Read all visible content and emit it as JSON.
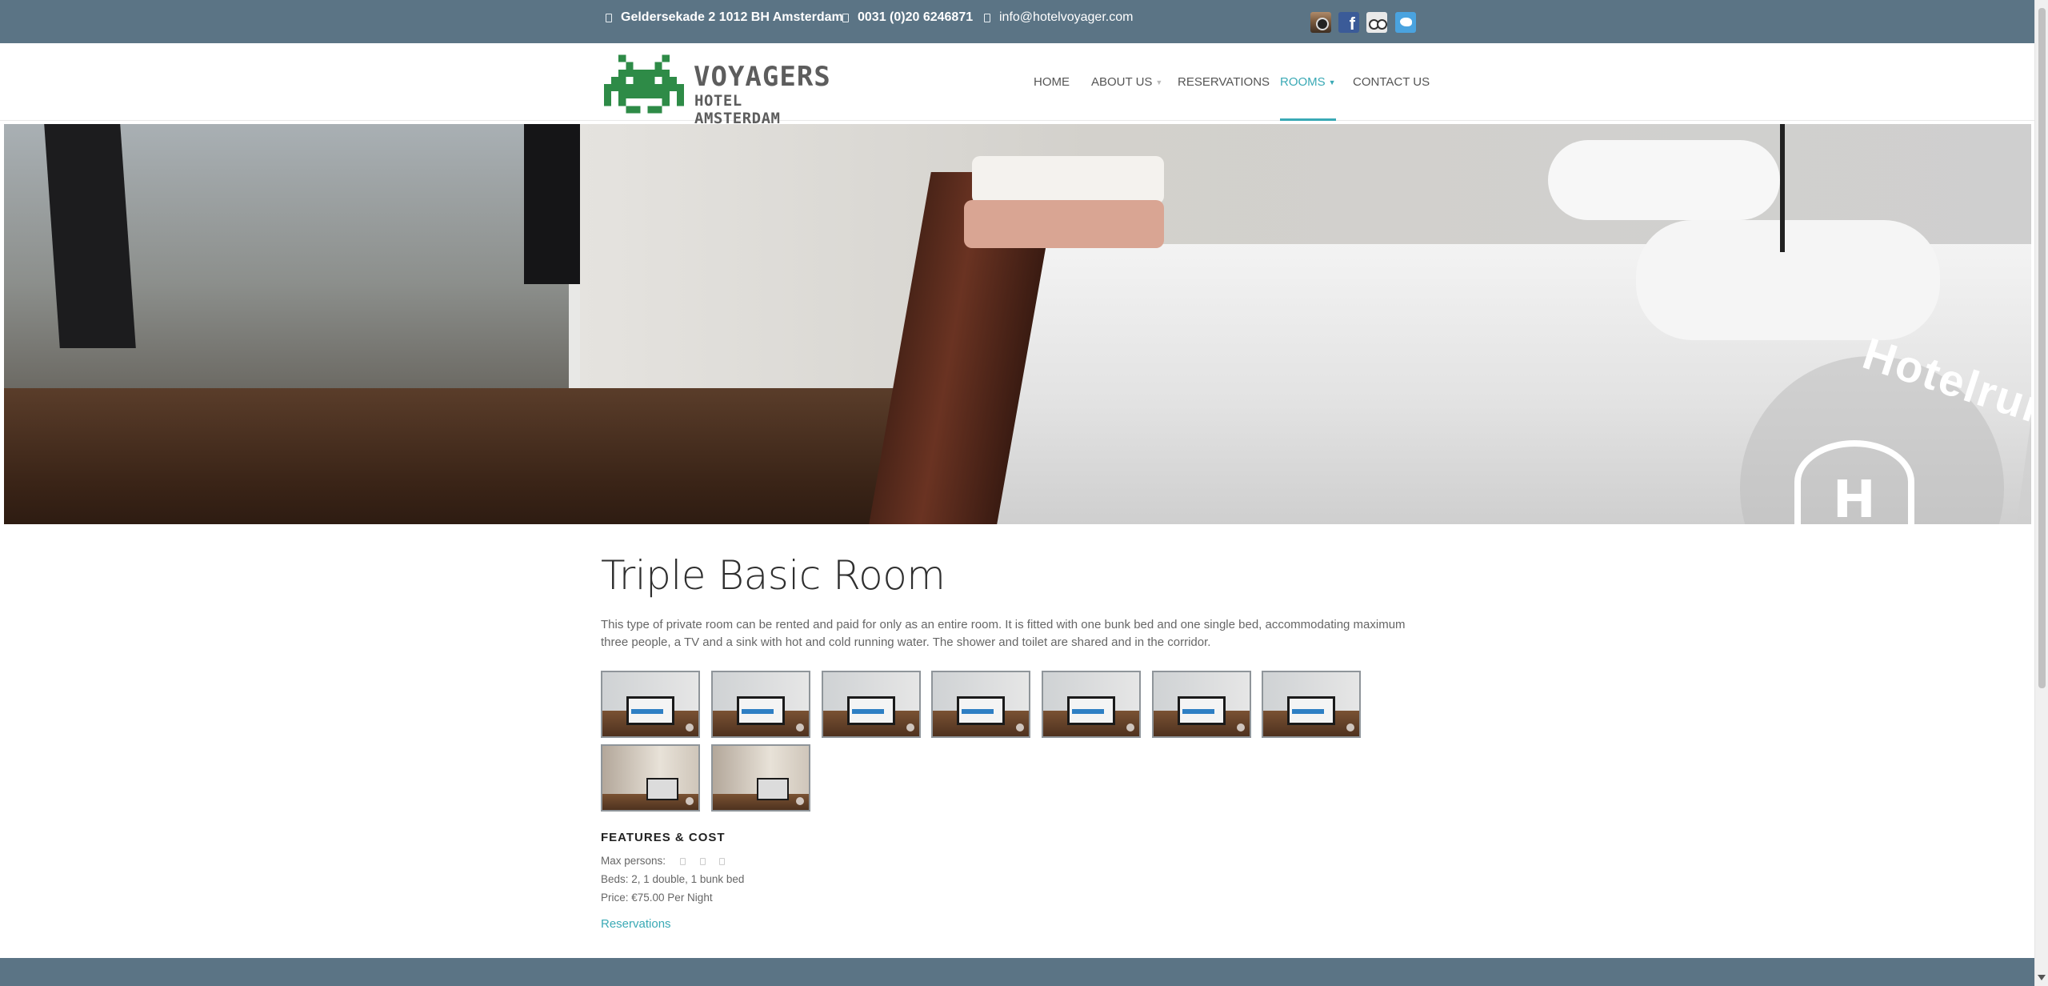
{
  "topbar": {
    "address": "Geldersekade 2 1012 BH Amsterdam",
    "phone": "0031 (0)20 6246871",
    "email": "info@hotelvoyager.com",
    "social": [
      "instagram-icon",
      "facebook-icon",
      "tripadvisor-icon",
      "twitter-icon"
    ],
    "background": "#5b7485"
  },
  "logo": {
    "line1": "VOYAGERS",
    "line2": "HOTEL AMSTERDAM",
    "accent": "#2e8b47"
  },
  "nav": {
    "items": [
      {
        "label": "HOME"
      },
      {
        "label": "ABOUT US",
        "has_dropdown": true
      },
      {
        "label": "RESERVATIONS"
      },
      {
        "label": "ROOMS",
        "has_dropdown": true,
        "active": true
      },
      {
        "label": "CONTACT US"
      }
    ],
    "active_color": "#3aa9b5"
  },
  "hero": {
    "watermark": "Hotelrun",
    "watermark_letter": "H"
  },
  "room": {
    "title": "Triple Basic Room",
    "description": "This type of private room can be rented and paid for only as an entire room. It is fitted with one bunk bed and one single bed, accommodating maximum three people, a TV and a sink with hot and cold running water. The shower and toilet are shared and in the corridor.",
    "thumbnail_count": 9
  },
  "features": {
    "title": "FEATURES & COST",
    "max_persons_label": "Max persons:",
    "max_persons": 3,
    "beds": "Beds: 2, 1 double, 1 bunk bed",
    "price": "Price: €75.00 Per Night",
    "reservations_link": "Reservations"
  }
}
